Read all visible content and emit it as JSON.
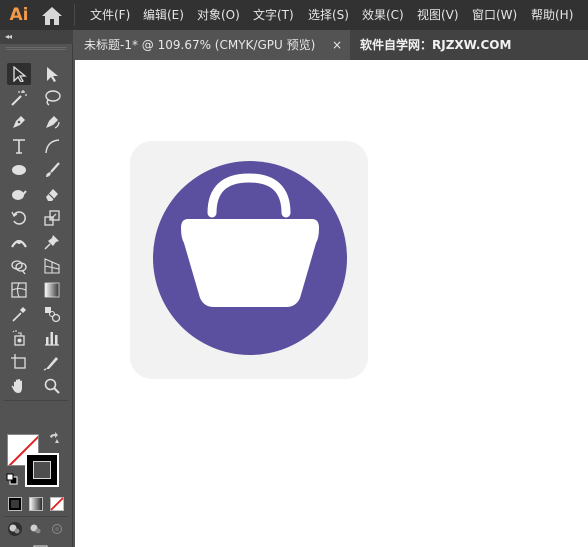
{
  "app": {
    "logo": "Ai"
  },
  "menu": {
    "items": [
      {
        "label": "文件(F)"
      },
      {
        "label": "编辑(E)"
      },
      {
        "label": "对象(O)"
      },
      {
        "label": "文字(T)"
      },
      {
        "label": "选择(S)"
      },
      {
        "label": "效果(C)"
      },
      {
        "label": "视图(V)"
      },
      {
        "label": "窗口(W)"
      },
      {
        "label": "帮助(H)"
      }
    ]
  },
  "tabs": {
    "active_label": "未标题-1* @ 109.67% (CMYK/GPU 预览)",
    "close_glyph": "×",
    "inactive_label": "软件自学网：RJZXW.COM"
  },
  "toolbar": {
    "collapse_glyph": "◂◂"
  },
  "colors": {
    "menubar_bg": "#323232",
    "panel_bg": "#535353",
    "canvas_bg": "#ffffff",
    "artwork_bg": "#f2f2f2",
    "circle_fill": "#5b509f",
    "bag_fill": "#ffffff",
    "logo_accent": "#f29a49"
  }
}
